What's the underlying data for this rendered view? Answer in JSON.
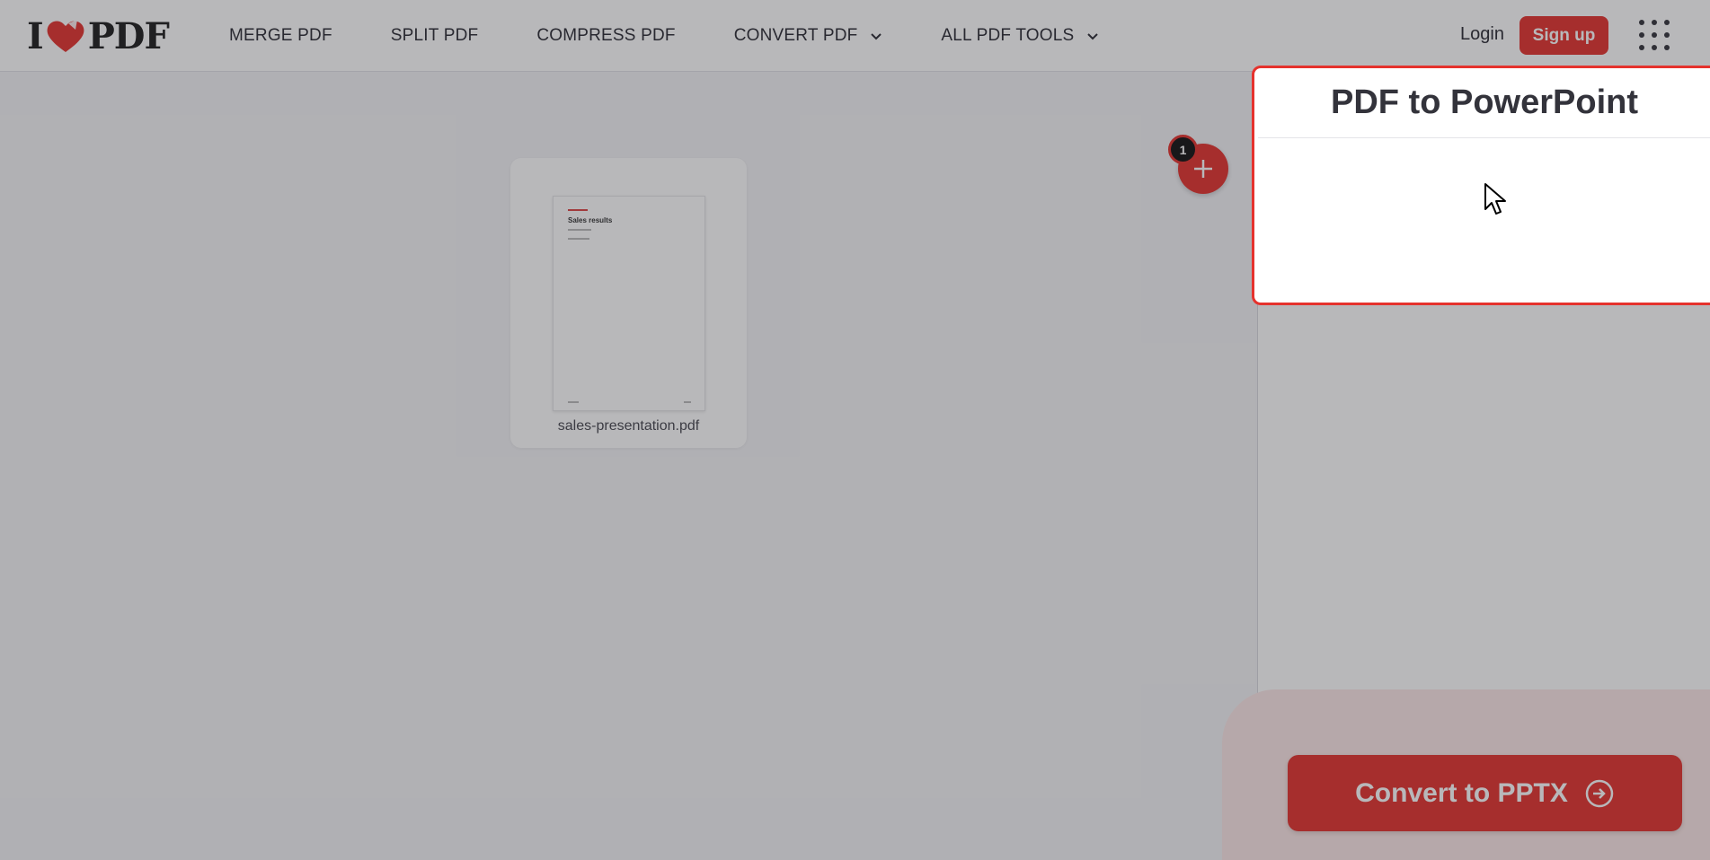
{
  "header": {
    "logo_left": "I",
    "logo_right": "PDF",
    "nav": [
      {
        "label": "MERGE PDF"
      },
      {
        "label": "SPLIT PDF"
      },
      {
        "label": "COMPRESS PDF"
      },
      {
        "label": "CONVERT PDF",
        "has_dropdown": true
      },
      {
        "label": "ALL PDF TOOLS",
        "has_dropdown": true
      }
    ],
    "login_label": "Login",
    "signup_label": "Sign up",
    "apps_icon": "grid-icon"
  },
  "workspace": {
    "file": {
      "name": "sales-presentation.pdf",
      "thumbnail_title": "Sales results"
    },
    "file_count": "1",
    "add_icon": "plus-icon"
  },
  "sidebar": {
    "tool_title": "PDF to PowerPoint",
    "convert_label": "Convert to PPTX",
    "convert_icon": "arrow-circle-right-icon"
  },
  "colors": {
    "brand_red": "#e5322d",
    "text_dark": "#33333b",
    "panel_pink": "#fde8e7"
  }
}
